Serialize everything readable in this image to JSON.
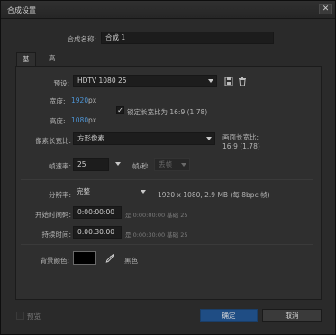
{
  "window": {
    "title": "合成设置",
    "close_label": "✕"
  },
  "comp_name": {
    "label": "合成名称:",
    "value": "合成 1"
  },
  "tabs": [
    {
      "label": "基本"
    },
    {
      "label": "高级"
    }
  ],
  "preset": {
    "label": "预设:",
    "value": "HDTV 1080 25"
  },
  "width": {
    "label": "宽度:",
    "value": "1920",
    "unit": "px"
  },
  "height": {
    "label": "高度:",
    "value": "1080",
    "unit": "px"
  },
  "lock_aspect": {
    "checked": true,
    "label": "锁定长宽比为 16:9 (1.78)"
  },
  "pixel_aspect": {
    "label": "像素长宽比:",
    "value": "方形像素"
  },
  "frame_aspect": {
    "label": "画面长宽比:",
    "value": "16:9 (1.78)"
  },
  "frame_rate": {
    "label": "帧速率:",
    "value": "25",
    "unit": "帧/秒",
    "drop_frame": "丢帧"
  },
  "resolution": {
    "label": "分辨率:",
    "value": "完整",
    "info": "1920 x 1080, 2.9 MB (每 8bpc 帧)"
  },
  "start_timecode": {
    "label": "开始时间码:",
    "value": "0:00:00:00",
    "info": "是 0:00:00:00  基础 25"
  },
  "duration": {
    "label": "持续时间:",
    "value": "0:00:30:00",
    "info": "是 0:00:30:00  基础 25"
  },
  "background_color": {
    "label": "背景颜色:",
    "color": "#000000",
    "name": "黑色"
  },
  "footer": {
    "preview_label": "预览",
    "ok_label": "确定",
    "cancel_label": "取消"
  },
  "colors": {
    "accent": "#4d93d2",
    "primary_button": "#1f4d84"
  }
}
